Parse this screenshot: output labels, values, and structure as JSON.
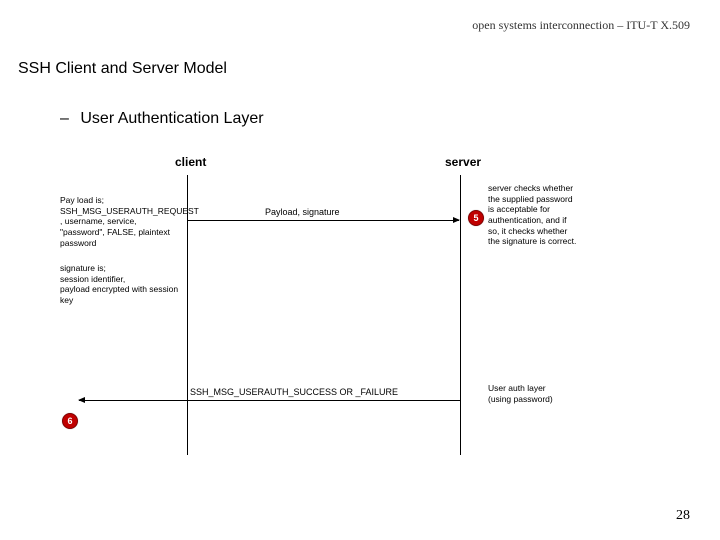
{
  "header": {
    "right": "open systems interconnection – ITU-T X.509"
  },
  "title": "SSH Client and Server Model",
  "subtitle": {
    "dash": "–",
    "text": "User Authentication Layer"
  },
  "diagram": {
    "client_label": "client",
    "server_label": "server",
    "payload_note": "Pay load is;\nSSH_MSG_USERAUTH_REQUEST\n, username, service,\n\"password\", FALSE, plaintext\npassword",
    "arrow1_label": "Payload, signature",
    "signature_note": "signature is;\nsession identifier,\npayload encrypted with session\nkey",
    "step5_right_num": "5",
    "server_check_note": "server checks whether\nthe supplied password\nis acceptable for\nauthentication, and if\nso, it checks whether\nthe signature is correct.",
    "arrow2_label": "SSH_MSG_USERAUTH_SUCCESS OR _FAILURE",
    "step6_num": "6",
    "userauth_layer_note": "User auth layer\n(using password)"
  },
  "page": "28"
}
